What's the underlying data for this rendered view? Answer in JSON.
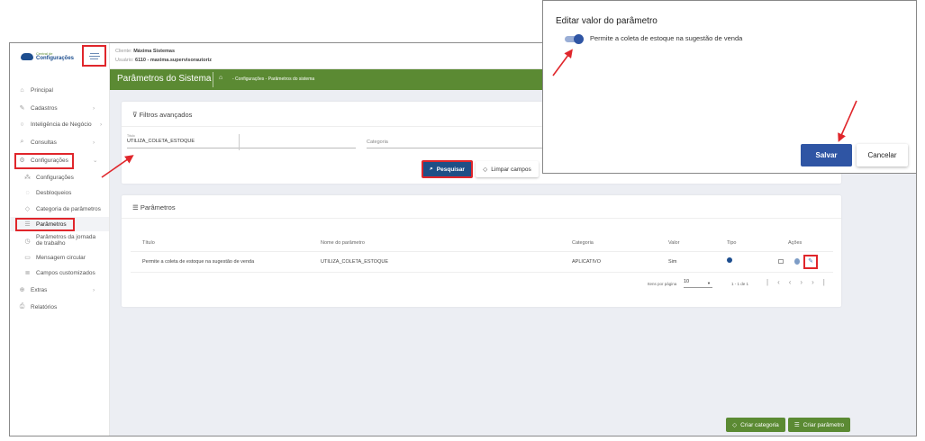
{
  "logo": {
    "top": "Central de",
    "bottom": "Configurações"
  },
  "topbar": {
    "client_label": "Cliente:",
    "client": "Máxima Sistemas",
    "user_label": "Usuário:",
    "user": "6110 - maxima.supervisorautoriz"
  },
  "header": {
    "title": "Parâmetros do Sistema",
    "breadcrumb": "- Configurações - Parâmetros do sistema"
  },
  "sidebar": {
    "items": [
      {
        "label": "Principal",
        "icon": "home-icon"
      },
      {
        "label": "Cadastros",
        "icon": "edit-icon"
      },
      {
        "label": "Inteligência de Negócio",
        "icon": "bulb-icon"
      },
      {
        "label": "Consultas",
        "icon": "search-icon"
      },
      {
        "label": "Configurações",
        "icon": "gear-icon"
      },
      {
        "label": "Extras",
        "icon": "plus-icon"
      },
      {
        "label": "Relatórios",
        "icon": "print-icon"
      }
    ],
    "subitems": [
      "Configurações",
      "Desbloqueios",
      "Categoria de parâmetros",
      "Parâmetros",
      "Parâmetros da jornada",
      "de trabalho",
      "Mensagem circular",
      "Campos customizados"
    ]
  },
  "filters": {
    "title": "Filtros avançados",
    "title_label": "Título",
    "title_value": "UTILIZA_COLETA_ESTOQUE",
    "category_placeholder": "Categoria",
    "search": "Pesquisar",
    "clear": "Limpar campos"
  },
  "params": {
    "title": "Parâmetros",
    "columns": [
      "Título",
      "Nome do parâmetro",
      "Categoria",
      "Valor",
      "Tipo",
      "Ações"
    ],
    "rows": [
      {
        "title": "Permite a coleta de estoque na sugestão de venda",
        "name": "UTILIZA_COLETA_ESTOQUE",
        "category": "APLICATIVO",
        "value": "Sim"
      }
    ],
    "per_page_label": "Itens por página",
    "per_page": "10",
    "range": "1 - 1 de 1"
  },
  "bottom": {
    "create_category": "Criar categoria",
    "create_param": "Criar parâmetro"
  },
  "dialog": {
    "title": "Editar valor do parâmetro",
    "toggle_label": "Permite a coleta de estoque na sugestão de venda",
    "toggle_on": true,
    "save": "Salvar",
    "cancel": "Cancelar"
  },
  "colors": {
    "green": "#5b8a33",
    "blue": "#2f55a4",
    "red": "#e0262b"
  }
}
